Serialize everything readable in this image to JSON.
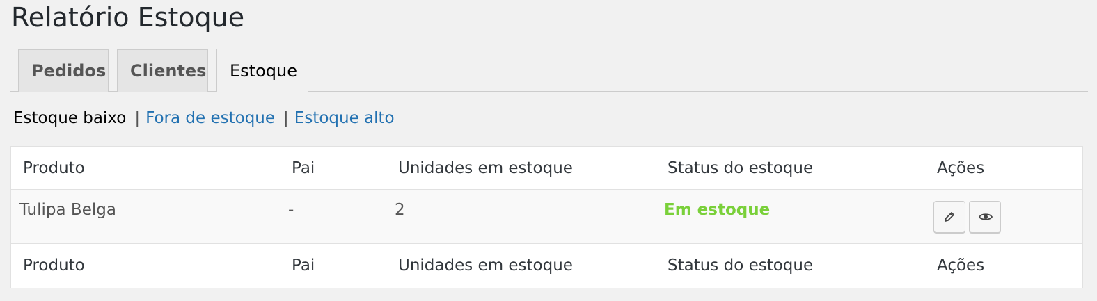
{
  "page": {
    "title": "Relatório Estoque"
  },
  "tabs": [
    {
      "label": "Pedidos",
      "active": false
    },
    {
      "label": "Clientes",
      "active": false
    },
    {
      "label": "Estoque",
      "active": true
    }
  ],
  "filters": {
    "current": "Estoque baixo",
    "separator": "|",
    "links": [
      "Fora de estoque",
      "Estoque alto"
    ]
  },
  "table": {
    "columns": [
      "Produto",
      "Pai",
      "Unidades em estoque",
      "Status do estoque",
      "Ações"
    ],
    "rows": [
      {
        "produto": "Tulipa Belga",
        "pai": "-",
        "unidades": "2",
        "status": "Em estoque",
        "actions": [
          "pencil-icon",
          "eye-icon"
        ]
      }
    ]
  },
  "colors": {
    "in_stock": "#7ad03a",
    "link": "#2271b1",
    "background": "#f1f1f1"
  }
}
